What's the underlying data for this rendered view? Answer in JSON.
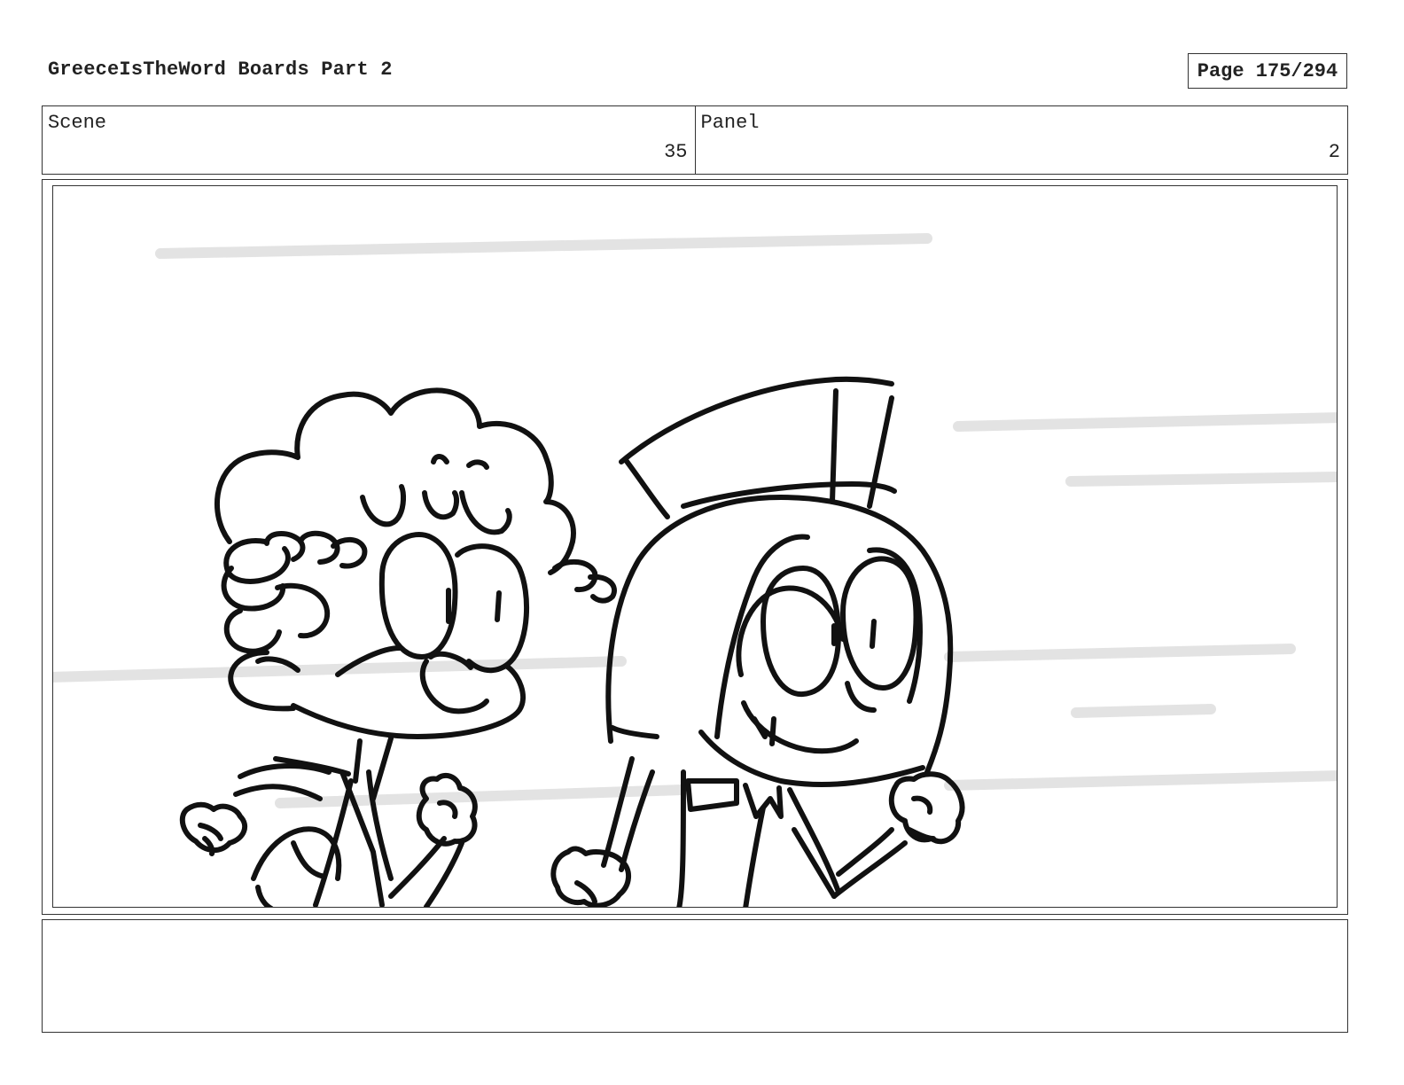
{
  "document": {
    "title": "GreeceIsTheWord Boards Part 2",
    "page_label": "Page 175/294"
  },
  "meta": {
    "scene_label": "Scene",
    "scene_value": "35",
    "panel_label": "Panel",
    "panel_value": "2"
  },
  "panel_art": {
    "description_icon": "storyboard-sketch-two-characters-running",
    "line_color": "#111111",
    "speed_line_color": "#e3e3e3"
  },
  "notes": {
    "text": ""
  }
}
